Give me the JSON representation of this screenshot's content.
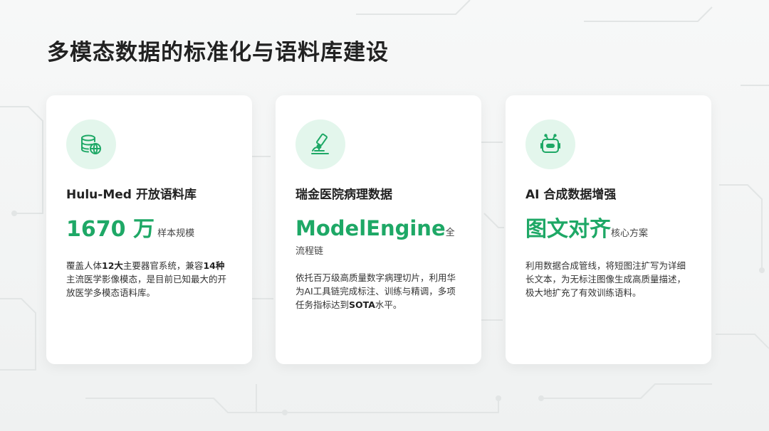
{
  "title": "多模态数据的标准化与语料库建设",
  "colors": {
    "accent": "#1ea866",
    "icon_bg": "#e3f6ec"
  },
  "cards": [
    {
      "icon": "database-globe-icon",
      "heading": "Hulu-Med 开放语料库",
      "stat_value": "1670 万",
      "stat_unit": "样本规模",
      "desc_parts": [
        "覆盖人体",
        "12大",
        "主要器官系统，兼容",
        "14种",
        "主流医学影像模态，是目前已知最大的开放医学多模态语料库。"
      ]
    },
    {
      "icon": "microscope-icon",
      "heading": "瑞金医院病理数据",
      "stat_value": "ModelEngine",
      "stat_unit": "全流程链",
      "desc_parts": [
        "依托百万级高质量数字病理切片，利用华为AI工具链完成标注、训练与精调，多项任务指标达到",
        "SOTA",
        "水平。"
      ]
    },
    {
      "icon": "robot-icon",
      "heading": "AI 合成数据增强",
      "stat_value": "图文对齐",
      "stat_unit": "核心方案",
      "desc_parts": [
        "利用数据合成管线，将短图注扩写为详细长文本，为无标注图像生成高质量描述，极大地扩充了有效训练语料。"
      ]
    }
  ]
}
